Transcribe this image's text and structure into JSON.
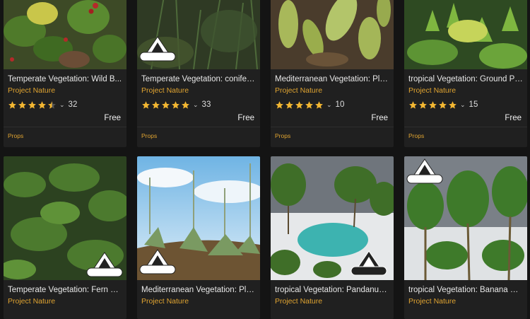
{
  "cards": [
    {
      "title": "Temperate Vegetation: Wild B...",
      "seller": "Project Nature",
      "rating": 4.5,
      "count": "32",
      "price": "Free",
      "category": "Props"
    },
    {
      "title": "Temperate Vegetation: conifer ...",
      "seller": "Project Nature",
      "rating": 5,
      "count": "33",
      "price": "Free",
      "category": "Props"
    },
    {
      "title": "Mediterranean Vegetation: Pla...",
      "seller": "Project Nature",
      "rating": 5,
      "count": "10",
      "price": "Free",
      "category": "Props"
    },
    {
      "title": "tropical Vegetation: Ground Pla...",
      "seller": "Project Nature",
      "rating": 5,
      "count": "15",
      "price": "Free",
      "category": "Props"
    },
    {
      "title": "Temperate Vegetation: Fern C...",
      "seller": "Project Nature"
    },
    {
      "title": "Mediterranean Vegetation: Pla...",
      "seller": "Project Nature"
    },
    {
      "title": "tropical Vegetation: Pandanus ...",
      "seller": "Project Nature"
    },
    {
      "title": "tropical Vegetation: Banana Pl...",
      "seller": "Project Nature"
    }
  ],
  "badge_text": "PROJECT NATURE",
  "colors": {
    "accent": "#e0a431",
    "star": "#f2b632",
    "card_bg": "#202020",
    "page_bg": "#141414"
  },
  "icons": {
    "star": "star-icon",
    "chevron": "chevron-down-icon"
  }
}
